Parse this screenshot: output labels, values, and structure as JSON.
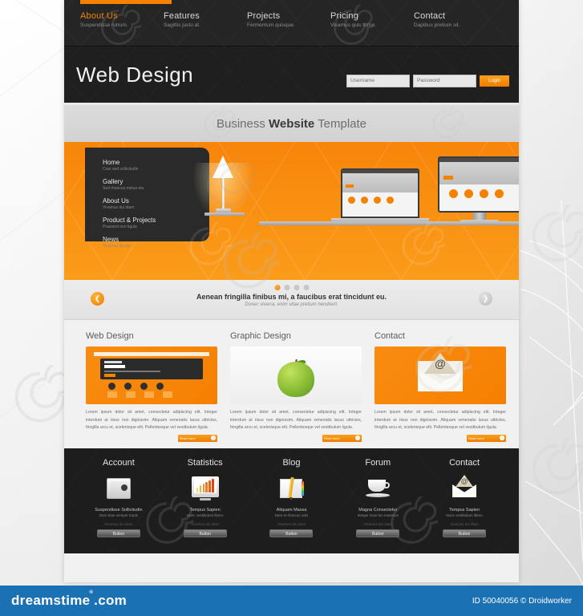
{
  "site": {
    "brand": "Web Design",
    "banner_prefix": "Business ",
    "banner_bold": "Website",
    "banner_suffix": " Template"
  },
  "nav": {
    "items": [
      {
        "label": "About Us",
        "sub": "Suspendisse rutrum.",
        "active": true
      },
      {
        "label": "Features",
        "sub": "Sagittis justo at.",
        "active": false
      },
      {
        "label": "Projects",
        "sub": "Fermentum quisque.",
        "active": false
      },
      {
        "label": "Pricing",
        "sub": "Vivamus quis tortor.",
        "active": false
      },
      {
        "label": "Contact",
        "sub": "Dapibus pretium sit.",
        "active": false
      }
    ]
  },
  "login": {
    "username_placeholder": "Username",
    "password_placeholder": "Password",
    "button_label": "Login"
  },
  "hero_menu": {
    "items": [
      {
        "label": "Home",
        "sub": "Cras sed sollicitudin"
      },
      {
        "label": "Gallery",
        "sub": "Sed rhoncus metus ela"
      },
      {
        "label": "About Us",
        "sub": "Vivamus dui diam"
      },
      {
        "label": "Product & Projects",
        "sub": "Praesent non ligula"
      },
      {
        "label": "News",
        "sub": "Vivamus iaculis"
      }
    ]
  },
  "slider": {
    "title": "Aenean fringilla finibus mi, a faucibus erat tincidunt eu.",
    "subtitle": "Donec viverra, enim vitae pretium hendrerit.",
    "prev_icon": "chevron-left-icon",
    "next_icon": "chevron-right-icon",
    "dots": [
      true,
      false,
      false,
      false
    ]
  },
  "columns": [
    {
      "title": "Web Design",
      "body": "Lorem ipsum dolor sit amet, consectetur adipiscing elit. Integer interdum at risus non dignissim. Aliquam venenatis lacus ultricies, fringilla arcu et, scelerisque elit. Pellentesque vel vestibulum ligula.",
      "button": "Read more",
      "thumb": "website-mockup"
    },
    {
      "title": "Graphic Design",
      "body": "Lorem ipsum dolor sit amet, consectetur adipiscing elit. Integer interdum at risus non dignissim. Aliquam venenatis lacus ultricies, fringilla arcu et, scelerisque elit. Pellentesque vel vestibulum ligula.",
      "button": "Read more",
      "thumb": "green-apple"
    },
    {
      "title": "Contact",
      "body": "Lorem ipsum dolor sit amet, consectetur adipiscing elit. Integer interdum at risus non dignissim. Aliquam venenatis lacus ultricies, fringilla arcu et, scelerisque elit. Pellentesque vel vestibulum ligula.",
      "button": "Read more",
      "thumb": "open-envelope"
    }
  ],
  "footer": {
    "columns": [
      {
        "title": "Account",
        "icon": "safe-icon",
        "line1": "Suspendisse Sollicitudin",
        "line2": "Duis vitae semper turpis",
        "line3": "Vivamus dui diam",
        "button": "Button"
      },
      {
        "title": "Statistics",
        "icon": "chart-monitor-icon",
        "line1": "Tempus Sapien",
        "line2": "Nunc vestibulum libero",
        "line3": "Vivamus dui diam",
        "button": "Button"
      },
      {
        "title": "Blog",
        "icon": "notebook-pencil-icon",
        "line1": "Aliquam Massa",
        "line2": "Nam et rhoncus odio",
        "line3": "Vivamus dui diam",
        "button": "Button"
      },
      {
        "title": "Forum",
        "icon": "coffee-cup-icon",
        "line1": "Magna Consectetur",
        "line2": "Integer risus leo maximus",
        "line3": "Vivamus dui diam",
        "button": "Button"
      },
      {
        "title": "Contact",
        "icon": "envelope-icon",
        "line1": "Tempus Sapien",
        "line2": "Nunc vestibulum libero",
        "line3": "Vivamus dui diam",
        "button": "Button"
      }
    ]
  },
  "watermark": {
    "site_name": "dreamstime",
    "site_tld": ".com",
    "image_id": "ID 50040056 © Droidworker"
  },
  "colors": {
    "accent": "#f58100",
    "dark": "#1f1f1f",
    "nav_bg": "#252525",
    "band": "#d8d8d8",
    "watermark_bar": "#1a72b5"
  },
  "chart_icon": {
    "bars": [
      6,
      9,
      11,
      13,
      15,
      17
    ],
    "colors": [
      "#f5d76e",
      "#f2b33d",
      "#f09226",
      "#ed7a1e",
      "#e85f16",
      "#e0450f"
    ]
  }
}
